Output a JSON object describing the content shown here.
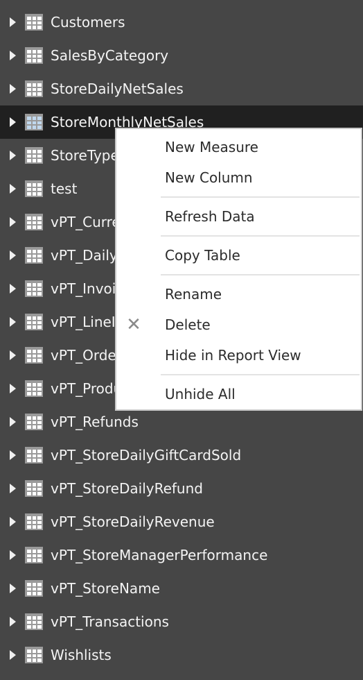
{
  "field_list": {
    "tables": [
      {
        "label": "Customers",
        "icon": "table-icon"
      },
      {
        "label": "SalesByCategory",
        "icon": "table-icon"
      },
      {
        "label": "StoreDailyNetSales",
        "icon": "table-icon"
      },
      {
        "label": "StoreMonthlyNetSales",
        "icon": "table-icon",
        "state": "hover"
      },
      {
        "label": "StoreType",
        "icon": "table-icon"
      },
      {
        "label": "test",
        "icon": "table-icon"
      },
      {
        "label": "vPT_Currency",
        "icon": "table-icon"
      },
      {
        "label": "vPT_Daily",
        "icon": "table-icon"
      },
      {
        "label": "vPT_Invoice",
        "icon": "table-icon"
      },
      {
        "label": "vPT_LineItem",
        "icon": "table-icon"
      },
      {
        "label": "vPT_Orders",
        "icon": "table-icon"
      },
      {
        "label": "vPT_Products",
        "icon": "table-icon"
      },
      {
        "label": "vPT_Refunds",
        "icon": "table-icon"
      },
      {
        "label": "vPT_StoreDailyGiftCardSold",
        "icon": "table-icon"
      },
      {
        "label": "vPT_StoreDailyRefund",
        "icon": "table-icon"
      },
      {
        "label": "vPT_StoreDailyRevenue",
        "icon": "table-icon"
      },
      {
        "label": "vPT_StoreManagerPerformance",
        "icon": "table-icon"
      },
      {
        "label": "vPT_StoreName",
        "icon": "table-icon"
      },
      {
        "label": "vPT_Transactions",
        "icon": "table-icon"
      },
      {
        "label": "Wishlists",
        "icon": "table-icon"
      }
    ]
  },
  "context_menu": {
    "items": [
      {
        "label": "New Measure"
      },
      {
        "label": "New Column"
      },
      {
        "label": "Refresh Data"
      },
      {
        "label": "Copy Table"
      },
      {
        "label": "Rename"
      },
      {
        "label": "Delete",
        "icon": "close-icon",
        "glyph": "✕"
      },
      {
        "label": "Hide in Report View"
      },
      {
        "label": "Unhide All"
      }
    ]
  },
  "colors": {
    "panel_background": "#464646",
    "hover_row": "#202020",
    "menu_background": "#ffffff",
    "menu_border": "#c8c8c8",
    "menu_text": "#2b2b2b",
    "row_text": "#f4f4f4"
  }
}
